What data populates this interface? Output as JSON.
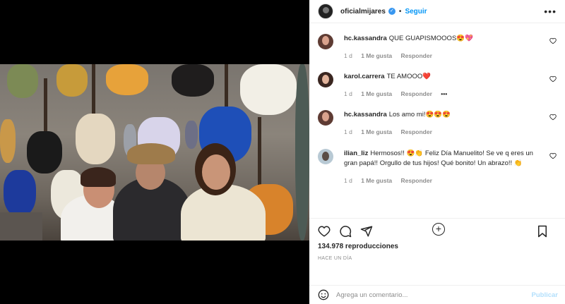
{
  "post": {
    "username": "oficialmijares",
    "follow_label": "Seguir",
    "more_label": "•••",
    "views": "134.978 reproducciones",
    "time": "HACE UN DÍA"
  },
  "comments": [
    {
      "user": "hc.kassandra",
      "text": "QUE GUAPISMOOOS😍💖",
      "time": "1 d",
      "likes": "1 Me gusta",
      "reply": "Responder"
    },
    {
      "user": "karol.carrera",
      "text": "TE AMOOO❤️",
      "time": "1 d",
      "likes": "1 Me gusta",
      "reply": "Responder",
      "extra": "•••"
    },
    {
      "user": "hc.kassandra",
      "text": "Los amo mi!😍😍😍",
      "time": "1 d",
      "likes": "1 Me gusta",
      "reply": "Responder"
    },
    {
      "user": "ilian_liz",
      "text": "Hermosos!! 😍👏 Feliz Día Manuelito! Se ve q eres un gran papá!! Orgullo de tus hijos! Qué bonito! Un abrazo!! 👏",
      "time": "1 d",
      "likes": "1 Me gusta",
      "reply": "Responder"
    }
  ],
  "composer": {
    "placeholder": "Agrega un comentario...",
    "publish_label": "Publicar"
  },
  "colors": {
    "accent": "#0095f6",
    "publish_disabled": "#b2dffc",
    "muted": "#8e8e8e"
  }
}
